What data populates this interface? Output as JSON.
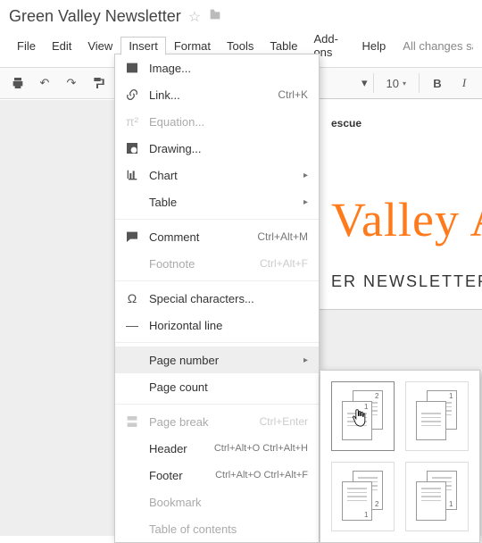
{
  "doc": {
    "title": "Green Valley Newsletter"
  },
  "menubar": {
    "file": "File",
    "edit": "Edit",
    "view": "View",
    "insert": "Insert",
    "format": "Format",
    "tools": "Tools",
    "table": "Table",
    "addons": "Add-ons",
    "help": "Help",
    "save_status": "All changes saved"
  },
  "toolbar": {
    "font_size": "10"
  },
  "insert_menu": {
    "image": "Image...",
    "link": "Link...",
    "link_short": "Ctrl+K",
    "equation": "Equation...",
    "drawing": "Drawing...",
    "chart": "Chart",
    "table": "Table",
    "comment": "Comment",
    "comment_short": "Ctrl+Alt+M",
    "footnote": "Footnote",
    "footnote_short": "Ctrl+Alt+F",
    "special": "Special characters...",
    "hr": "Horizontal line",
    "page_number": "Page number",
    "page_count": "Page count",
    "page_break": "Page break",
    "page_break_short": "Ctrl+Enter",
    "header": "Header",
    "header_short": "Ctrl+Alt+O Ctrl+Alt+H",
    "footer": "Footer",
    "footer_short": "Ctrl+Alt+O Ctrl+Alt+F",
    "bookmark": "Bookmark",
    "toc": "Table of contents"
  },
  "page_number_submenu": {
    "opt1": "header-all-pages",
    "opt2": "header-skip-first",
    "opt3": "footer-all-pages",
    "opt4": "footer-skip-first"
  },
  "document": {
    "breadcrumb": "escue",
    "headline": "Valley A",
    "subhead": "ER NEWSLETTER"
  },
  "icons": {
    "star": "☆",
    "folder": "▇",
    "print": "🖶",
    "undo": "↶",
    "redo": "↷",
    "paint": "✎",
    "bold": "B",
    "italic": "I",
    "image": "▣",
    "link": "🔗",
    "equation": "π²",
    "drawing": "◩",
    "chart": "▥",
    "comment": "💬",
    "special": "Ω",
    "hr": "—",
    "pagebreak": "⎙",
    "triangle_down": "▾",
    "triangle_right": "▸",
    "hand": "👆"
  }
}
